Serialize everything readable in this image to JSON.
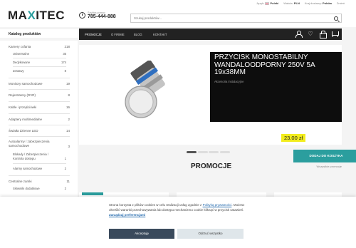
{
  "topbar": {
    "lang_label": "Język:",
    "lang_value": "Polski",
    "currency_label": "Waluta:",
    "currency_value": "PLN",
    "country_label": "Kraj dostawy:",
    "country_value": "Polska",
    "more": "Zmień"
  },
  "header": {
    "logo_pre": "MA",
    "logo_x": "X",
    "logo_post": "ITEC",
    "phone_label": "Szybka pomoc",
    "phone_number": "785-444-888",
    "search_placeholder": "Szukaj produktów..."
  },
  "sidebar": {
    "title": "Katalog produktów",
    "items": [
      {
        "label": "Kamery cofania",
        "count": "218"
      },
      {
        "label": "Uniwersalne",
        "count": "35"
      },
      {
        "label": "Dedykowane",
        "count": "174"
      },
      {
        "label": "Zestawy",
        "count": "8"
      },
      {
        "label": "Monitory samochodowe",
        "count": "19"
      },
      {
        "label": "Rejestratory (DVR)",
        "count": "8"
      },
      {
        "label": "Kable i przejściówki",
        "count": "16"
      },
      {
        "label": "Adaptery multimedialne",
        "count": "2"
      },
      {
        "label": "Światła dzienne LED",
        "count": "14"
      },
      {
        "label": "Autoalarmy / zabezpieczenia samochodowe",
        "count": "3"
      },
      {
        "label": "Blokady / Zabezpieczenia / Kontrola dostępu",
        "count": "1"
      },
      {
        "label": "Alarmy samochodowe",
        "count": "2"
      },
      {
        "label": "Centralne zamki",
        "count": "11"
      },
      {
        "label": "Siłowniki dodatkowe",
        "count": "2"
      }
    ]
  },
  "nav": {
    "tabs": [
      "PROMOCJE",
      "O FIRMIE",
      "BLOG",
      "KONTAKT"
    ]
  },
  "banner": {
    "title": "PRZYCISK MONOSTABILNY WANDALOODPORNY 250V 5A 19x38MM",
    "category": "Akcesoria instalacyjne",
    "price": "23.00 zł",
    "add_to_cart": "DODAJ DO KOSZYKA"
  },
  "promotions": {
    "heading": "PROMOCJE",
    "all_link": "Wszystkie promocje"
  },
  "cookie": {
    "line1_pre": "Strona korzysta z plików cookies w celu realizacji usług zgodnie z",
    "line1_link": "Polityką prywatności",
    "line2": ". Możesz określić warunki przechowywania lub dostępu mechanizmu cookie kliknąć w przycisk ustawień.",
    "settings_link": "Zarządzaj preferencjami",
    "accept": "Akceptuję",
    "reject": "Odrzuć wszystko"
  },
  "colors": {
    "accent": "#2b9e9e",
    "nav_bg": "#222222",
    "price_bg": "#f2ec1c",
    "accept_bg": "#3a4a5c"
  }
}
